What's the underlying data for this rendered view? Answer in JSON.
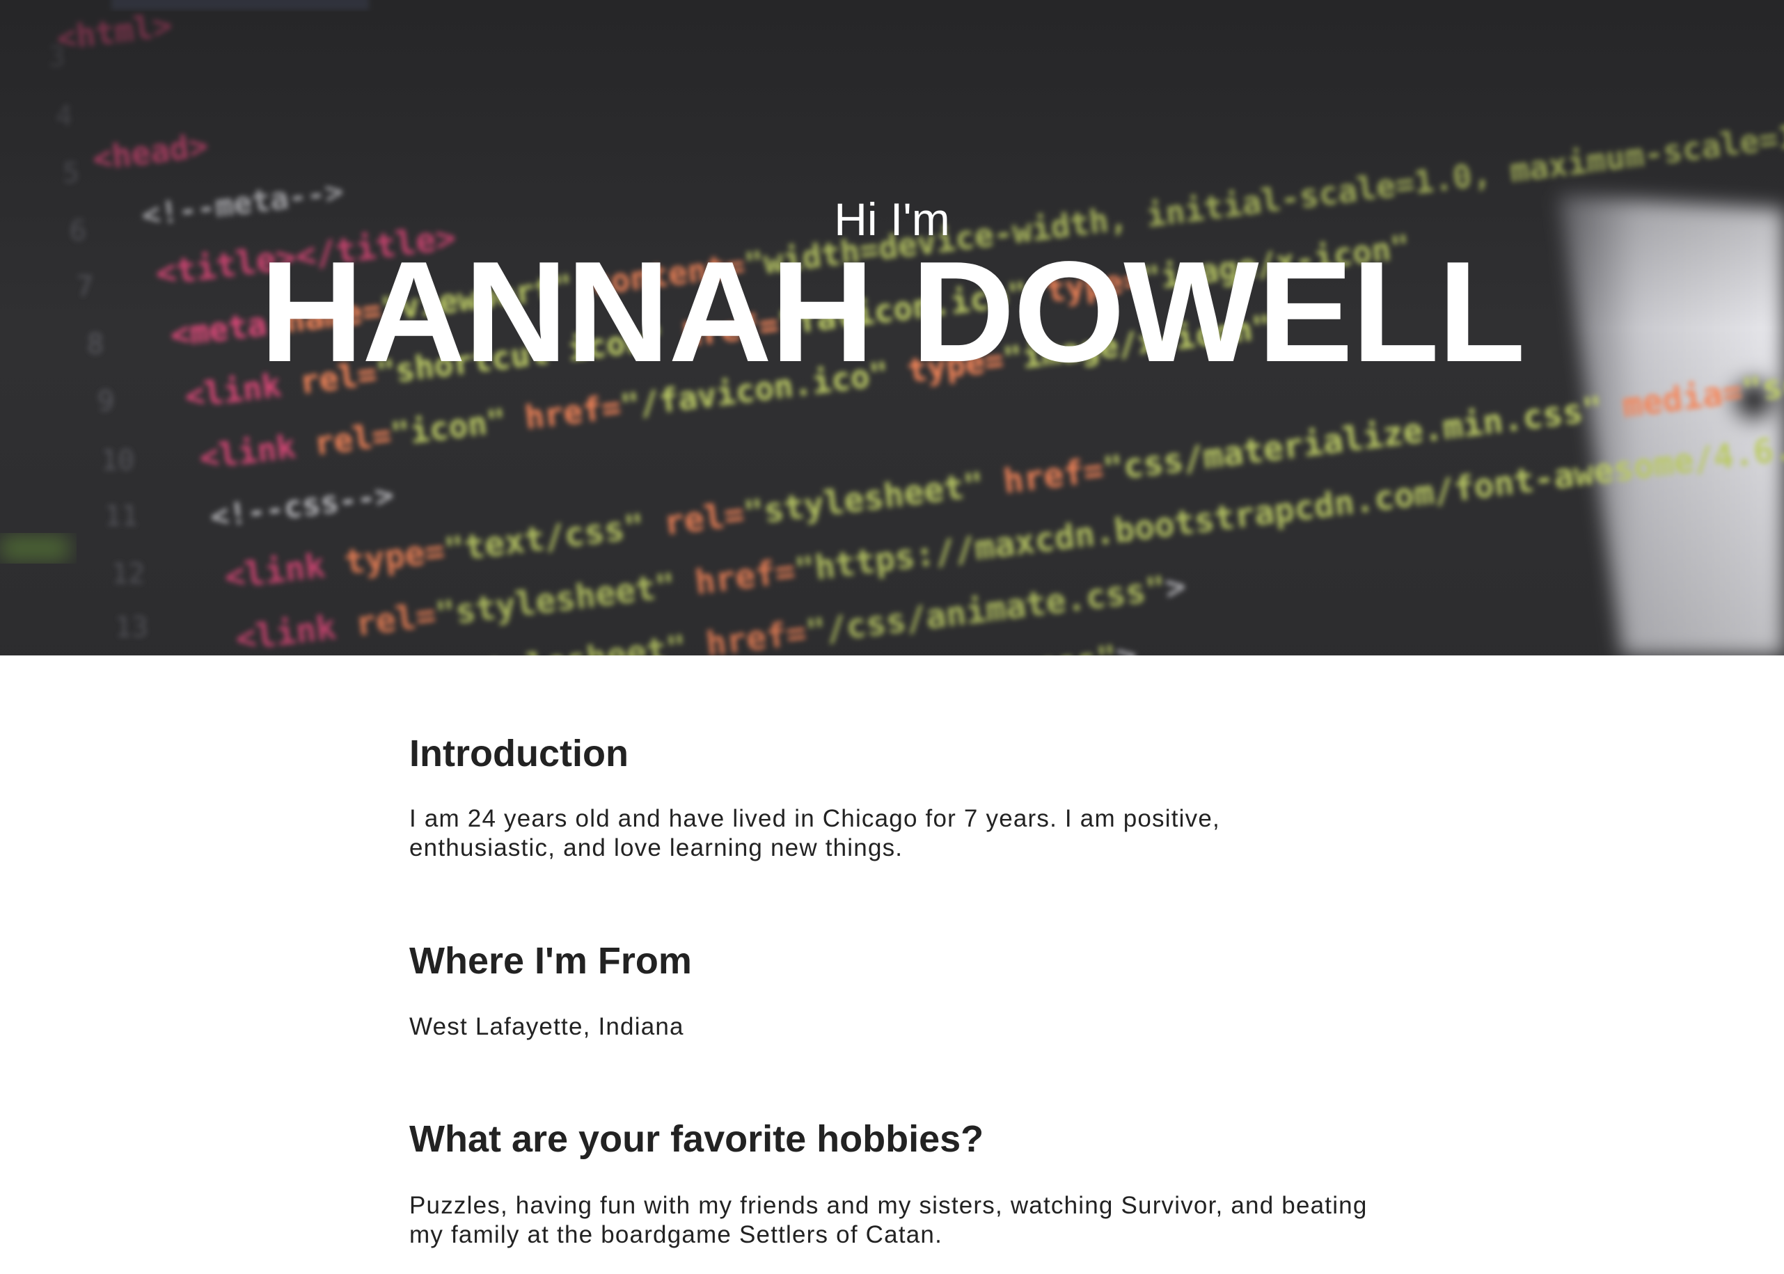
{
  "hero": {
    "greeting": "Hi I'm",
    "name": "HANNAH DOWELL"
  },
  "sections": [
    {
      "heading": "Introduction",
      "body": "I am 24 years old and have lived in Chicago for 7 years. I am positive, enthusiastic, and love learning new things."
    },
    {
      "heading": "Where I'm From",
      "body": "West Lafayette, Indiana"
    },
    {
      "heading": "What are your favorite hobbies?",
      "body": "Puzzles, having fun with my friends and my sisters, watching Survivor, and beating my family at the boardgame Settlers of Catan."
    }
  ]
}
